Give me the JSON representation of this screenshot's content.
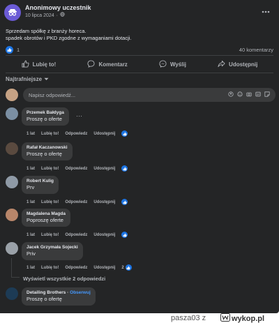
{
  "post": {
    "author": "Anonimowy uczestnik",
    "date": "10 lipca 2024",
    "date_sep": "·",
    "body_line1": "Sprzedam spółkę z branży horeca.",
    "body_line2": "spadek obrotów i PKD zgodne z wymaganiami dotacji.",
    "reactions_count": "1",
    "comments_count": "40 komentarzy"
  },
  "actions": {
    "like": "Lubię to!",
    "comment": "Komentarz",
    "send": "Wyślij",
    "share": "Udostępnij"
  },
  "sort_label": "Najtrafniejsze",
  "composer": {
    "placeholder": "Napisz odpowiedź..."
  },
  "comments": [
    {
      "name": "Przemek Bałdyga",
      "text": "Proszę o oferte",
      "time": "1 lat",
      "like": "Lubię to!",
      "reply": "Odpowiedz",
      "share": "Udostępnij"
    },
    {
      "name": "Rafał Kaczanowski",
      "text": "Proszę o ofertę",
      "time": "1 lat",
      "like": "Lubię to!",
      "reply": "Odpowiedz",
      "share": "Udostępnij"
    },
    {
      "name": "Robert Kulig",
      "text": "Prv",
      "time": "1 lat",
      "like": "Lubię to!",
      "reply": "Odpowiedz",
      "share": "Udostępnij"
    },
    {
      "name": "Magdalena Magda",
      "text": "Poproszę oferte",
      "time": "1 lat",
      "like": "Lubię to!",
      "reply": "Odpowiedz",
      "share": "Udostępnij"
    },
    {
      "name": "Jacek Grzymała Sojecki",
      "text": "Priv",
      "time": "1 lat",
      "like": "Lubię to!",
      "reply": "Odpowiedz",
      "share": "Udostępnij",
      "likes": "2"
    },
    {
      "name": "Detailing Brothers",
      "follow": "Obserwuj",
      "text": "Proszę o ofertę"
    }
  ],
  "view_replies": "Wyświetl wszystkie 2 odpowiedzi",
  "watermark": {
    "user": "pasza03",
    "sep": "z",
    "site": "wykop.pl"
  },
  "colors": {
    "background": "#242526",
    "bubble": "#3a3b3c",
    "accent": "#1b74e4"
  }
}
